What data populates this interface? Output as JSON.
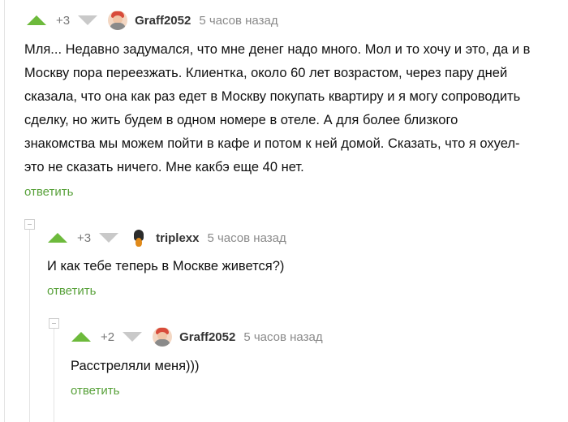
{
  "comments": [
    {
      "rating": "+3",
      "author": "Graff2052",
      "time": "5 часов назад",
      "text_lines": [
        "Мля... Недавно задумался, что мне денег надо много. Мол и то хочу и это, да и в",
        "Москву пора переезжать. Клиентка, около 60 лет возрастом, через пару дней",
        "сказала, что она как раз едет в Москву покупать квартиру и я могу сопроводить",
        "сделку, но жить будем в одном номере в отеле. А для более близкого",
        "знакомства мы можем пойти в кафе и потом к ней домой. Сказать, что я охуел-",
        "это не сказать ничего. Мне какбэ еще 40 нет."
      ],
      "reply": "ответить"
    },
    {
      "rating": "+3",
      "author": "triplexx",
      "time": "5 часов назад",
      "text": "И как тебе теперь в Москве живется?)",
      "reply": "ответить"
    },
    {
      "rating": "+2",
      "author": "Graff2052",
      "time": "5 часов назад",
      "text": "Расстреляли меня)))",
      "reply": "ответить"
    }
  ],
  "colors": {
    "accent_green": "#6dba3c",
    "reply_green": "#58a13a",
    "muted": "#8a8a8a"
  },
  "icons": [
    "upvote-icon",
    "downvote-icon",
    "collapse-icon"
  ]
}
